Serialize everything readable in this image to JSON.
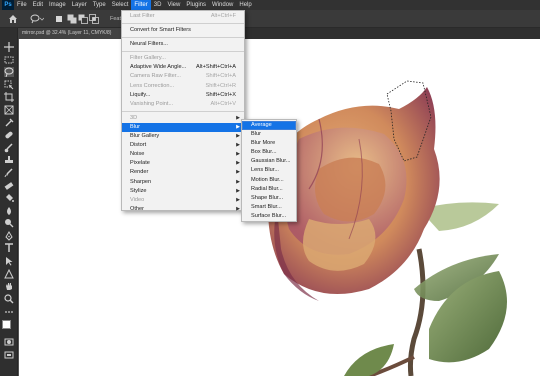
{
  "app": {
    "logo": "Ps"
  },
  "menubar": {
    "items": [
      {
        "label": "File"
      },
      {
        "label": "Edit"
      },
      {
        "label": "Image"
      },
      {
        "label": "Layer"
      },
      {
        "label": "Type"
      },
      {
        "label": "Select"
      },
      {
        "label": "Filter"
      },
      {
        "label": "3D"
      },
      {
        "label": "View"
      },
      {
        "label": "Plugins"
      },
      {
        "label": "Window"
      },
      {
        "label": "Help"
      }
    ]
  },
  "options_bar": {
    "feather_label": "Feath"
  },
  "document": {
    "tab_title": "mirror.psd @ 32.4% (Layer 11, CMYK/8)"
  },
  "filter_menu": {
    "last_filter": {
      "label": "Last Filter",
      "shortcut": "Alt+Ctrl+F"
    },
    "convert_smart": {
      "label": "Convert for Smart Filters"
    },
    "neural": {
      "label": "Neural Filters..."
    },
    "filter_gallery": {
      "label": "Filter Gallery..."
    },
    "adaptive_wide": {
      "label": "Adaptive Wide Angle...",
      "shortcut": "Alt+Shift+Ctrl+A"
    },
    "camera_raw": {
      "label": "Camera Raw Filter...",
      "shortcut": "Shift+Ctrl+A"
    },
    "lens_correction": {
      "label": "Lens Correction...",
      "shortcut": "Shift+Ctrl+R"
    },
    "liquify": {
      "label": "Liquify...",
      "shortcut": "Shift+Ctrl+X"
    },
    "vanishing_point": {
      "label": "Vanishing Point...",
      "shortcut": "Alt+Ctrl+V"
    },
    "submenus": [
      {
        "label": "3D"
      },
      {
        "label": "Blur"
      },
      {
        "label": "Blur Gallery"
      },
      {
        "label": "Distort"
      },
      {
        "label": "Noise"
      },
      {
        "label": "Pixelate"
      },
      {
        "label": "Render"
      },
      {
        "label": "Sharpen"
      },
      {
        "label": "Stylize"
      },
      {
        "label": "Video"
      },
      {
        "label": "Other"
      }
    ]
  },
  "blur_menu": {
    "items": [
      {
        "label": "Average"
      },
      {
        "label": "Blur"
      },
      {
        "label": "Blur More"
      },
      {
        "label": "Box Blur..."
      },
      {
        "label": "Gaussian Blur..."
      },
      {
        "label": "Lens Blur..."
      },
      {
        "label": "Motion Blur..."
      },
      {
        "label": "Radial Blur..."
      },
      {
        "label": "Shape Blur..."
      },
      {
        "label": "Smart Blur..."
      },
      {
        "label": "Surface Blur..."
      }
    ]
  },
  "colors": {
    "highlight": "#1473e6",
    "menubar_bg": "#323232",
    "canvas_bg": "#ffffff"
  }
}
